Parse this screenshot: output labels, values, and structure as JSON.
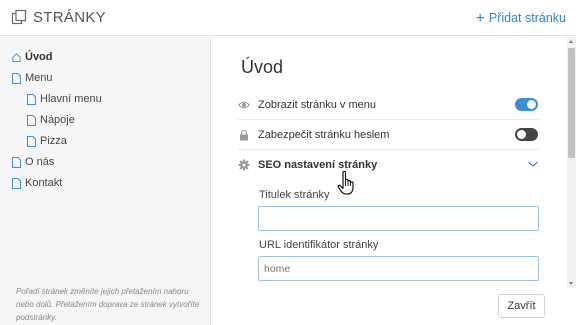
{
  "header": {
    "title": "STRÁNKY",
    "title_icon": "pages-icon",
    "add_label": "Přidat stránku",
    "add_icon": "plus-icon",
    "accent_color": "#2a87d6"
  },
  "sidebar": {
    "items": [
      {
        "label": "Úvod",
        "icon": "home-icon",
        "active": true
      },
      {
        "label": "Menu",
        "icon": "page-icon"
      },
      {
        "label": "Hlavní menu",
        "icon": "page-icon"
      },
      {
        "label": "Nápoje",
        "icon": "page-icon"
      },
      {
        "label": "Pizza",
        "icon": "page-icon"
      },
      {
        "label": "O nás",
        "icon": "page-icon"
      },
      {
        "label": "Kontakt",
        "icon": "page-icon"
      }
    ],
    "hint": "Pořadí stránek změníte jejich přetažením nahoru nebo dolů. Přetažením doprava ze stránek vytvoříte podstránky."
  },
  "main": {
    "title": "Úvod",
    "options": [
      {
        "label": "Zobrazit stránku v menu",
        "icon": "eye-icon",
        "enabled": true
      },
      {
        "label": "Zabezpečit stránku heslem",
        "icon": "lock-icon",
        "enabled": false
      }
    ],
    "seo": {
      "label": "SEO nastavení stránky",
      "icon": "gear-icon",
      "expanded": true,
      "fields": [
        {
          "label": "Titulek stránky",
          "value": "",
          "placeholder": ""
        },
        {
          "label": "URL identifikátor stránky",
          "value": "",
          "placeholder": "home"
        }
      ]
    },
    "close_label": "Zavřít",
    "toggle_on_color": "#3a8fd9",
    "toggle_off_color": "#444444"
  }
}
